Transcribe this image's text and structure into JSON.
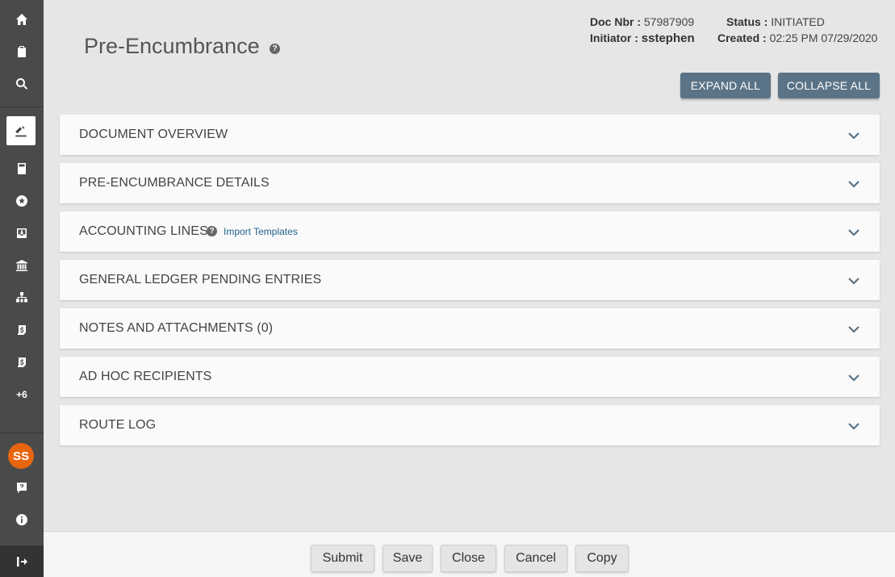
{
  "sidebar": {
    "items": [
      {
        "icon": "home-icon"
      },
      {
        "icon": "clipboard-icon"
      },
      {
        "icon": "search-icon"
      },
      {
        "icon": "document-pen-icon"
      },
      {
        "icon": "calculator-icon"
      },
      {
        "icon": "star-icon"
      },
      {
        "icon": "inbox-icon"
      },
      {
        "icon": "bank-icon"
      },
      {
        "icon": "org-chart-icon"
      },
      {
        "icon": "dollar-scroll-icon"
      },
      {
        "icon": "dollar-scroll-alt-icon"
      }
    ],
    "more_label": "+6",
    "avatar_initials": "SS",
    "avatar_color": "#e8650f"
  },
  "header": {
    "title": "Pre-Encumbrance",
    "doc_nbr_label": "Doc Nbr :",
    "doc_nbr_value": "57987909",
    "status_label": "Status :",
    "status_value": "INITIATED",
    "initiator_label": "Initiator :",
    "initiator_value": "sstephen",
    "created_label": "Created :",
    "created_value": "02:25 PM 07/29/2020",
    "expand_all": "EXPAND ALL",
    "collapse_all": "COLLAPSE ALL"
  },
  "sections": [
    {
      "title": "DOCUMENT OVERVIEW"
    },
    {
      "title": "PRE-ENCUMBRANCE DETAILS"
    },
    {
      "title": "ACCOUNTING LINES",
      "link": "Import Templates"
    },
    {
      "title": "GENERAL LEDGER PENDING ENTRIES"
    },
    {
      "title": "NOTES AND ATTACHMENTS (0)"
    },
    {
      "title": "AD HOC RECIPIENTS"
    },
    {
      "title": "ROUTE LOG"
    }
  ],
  "footer": {
    "submit": "Submit",
    "save": "Save",
    "close": "Close",
    "cancel": "Cancel",
    "copy": "Copy"
  },
  "colors": {
    "accent": "#5b7386",
    "sidebar": "#4a4a4a",
    "link": "#1f5f8b"
  }
}
